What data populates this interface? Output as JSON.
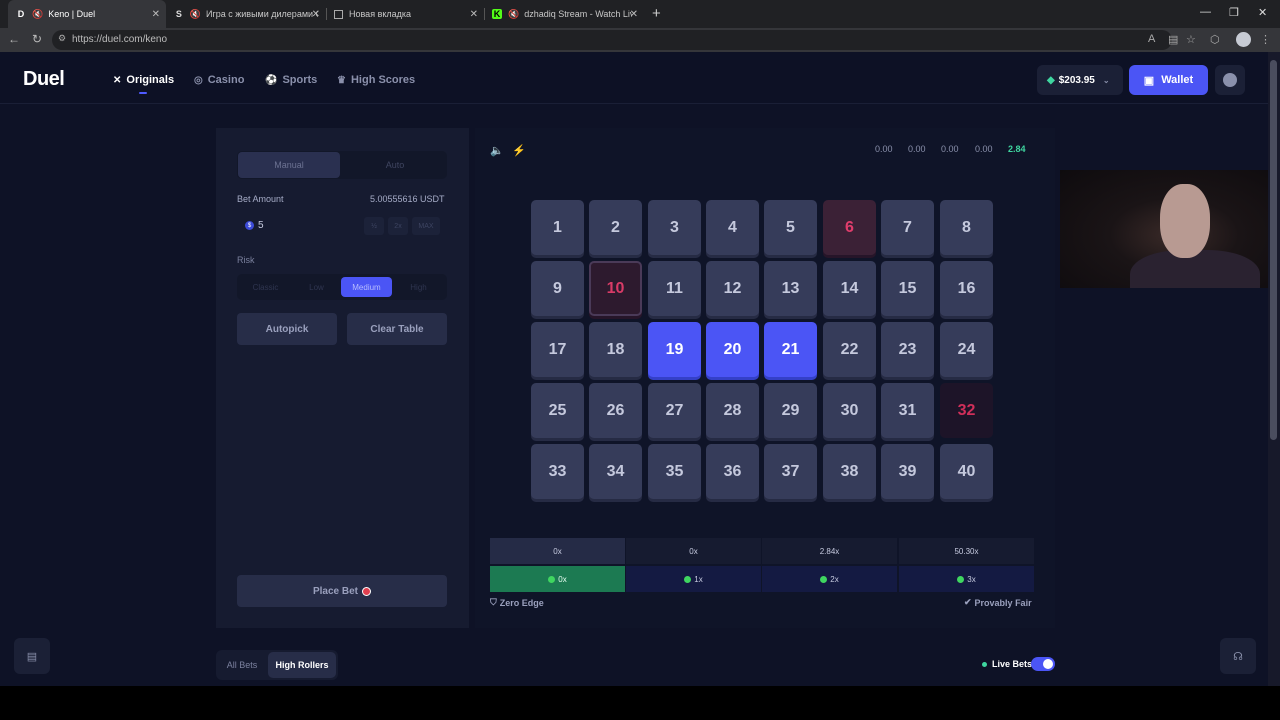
{
  "browser": {
    "tabs": [
      {
        "title": "Keno | Duel",
        "favicon": "D",
        "muted": true
      },
      {
        "title": "Игра с живыми дилерами Ст",
        "favicon": "S",
        "muted": true
      },
      {
        "title": "Новая вкладка",
        "favicon": "page",
        "muted": false
      },
      {
        "title": "dzhadiq Stream - Watch Live",
        "favicon": "K",
        "muted": true
      }
    ],
    "url": "https://duel.com/keno"
  },
  "header": {
    "logo": "Duel",
    "nav": [
      "Originals",
      "Casino",
      "Sports",
      "High Scores"
    ],
    "balance": "$203.95",
    "wallet_label": "Wallet"
  },
  "left_panel": {
    "mode_tabs": [
      "Manual",
      "Auto"
    ],
    "bet_amount_label": "Bet Amount",
    "bet_amount_usdt": "5.00555616 USDT",
    "bet_value": "5",
    "bet_buttons": [
      "½",
      "2x",
      "MAX"
    ],
    "risk_label": "Risk",
    "risk_options": [
      "Classic",
      "Low",
      "Medium",
      "High"
    ],
    "risk_selected": "Medium",
    "autopick_label": "Autopick",
    "clear_label": "Clear Table",
    "place_bet_label": "Place Bet"
  },
  "game": {
    "history": [
      "0.00",
      "0.00",
      "0.00",
      "0.00",
      "2.84"
    ],
    "numbers": [
      1,
      2,
      3,
      4,
      5,
      6,
      7,
      8,
      9,
      10,
      11,
      12,
      13,
      14,
      15,
      16,
      17,
      18,
      19,
      20,
      21,
      22,
      23,
      24,
      25,
      26,
      27,
      28,
      29,
      30,
      31,
      32,
      33,
      34,
      35,
      36,
      37,
      38,
      39,
      40
    ],
    "selected": [
      19,
      20,
      21
    ],
    "drawn_miss": [
      6,
      10,
      32
    ],
    "payout_multipliers": [
      "0x",
      "0x",
      "2.84x",
      "50.30x"
    ],
    "payout_hits": [
      "0x",
      "1x",
      "2x",
      "3x"
    ],
    "zero_edge_label": "Zero Edge",
    "provably_fair_label": "Provably Fair"
  },
  "bottom": {
    "bet_tabs": [
      "All Bets",
      "High Rollers"
    ],
    "active_bet_tab": "High Rollers",
    "live_bets_label": "Live Bets",
    "live_bets_on": true
  },
  "colors": {
    "accent": "#4b55f5",
    "success": "#3fd6a0",
    "miss": "#e03d6c"
  }
}
